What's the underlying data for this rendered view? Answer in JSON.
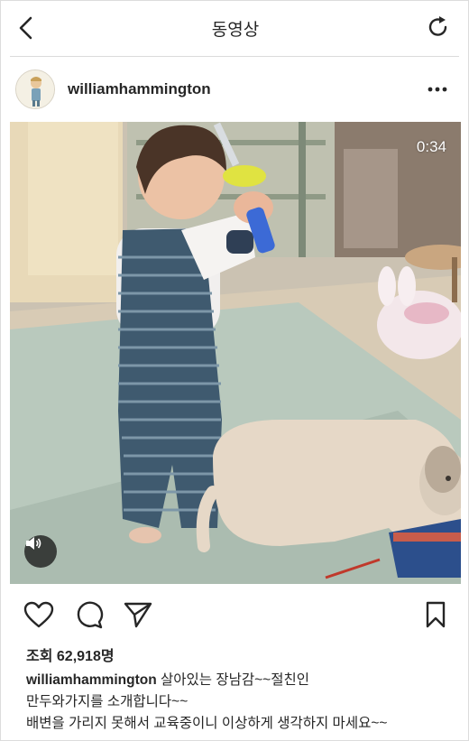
{
  "navbar": {
    "title": "동영상"
  },
  "post": {
    "username": "williamhammington",
    "video_duration": "0:34",
    "views_label": "조회",
    "views_count": "62,918명",
    "caption_line1": "살아있는 장남감~~절친인",
    "caption_line2": "만두와가지를 소개합니다~~",
    "caption_line3": "배변을 가리지 못해서 교육중이니 이상하게 생각하지 마세요~~"
  },
  "icons": {
    "back": "chevron-left-icon",
    "refresh": "refresh-icon",
    "more": "more-horizontal-icon",
    "mute": "speaker-icon",
    "like": "heart-icon",
    "comment": "comment-icon",
    "share": "send-icon",
    "save": "bookmark-icon"
  }
}
